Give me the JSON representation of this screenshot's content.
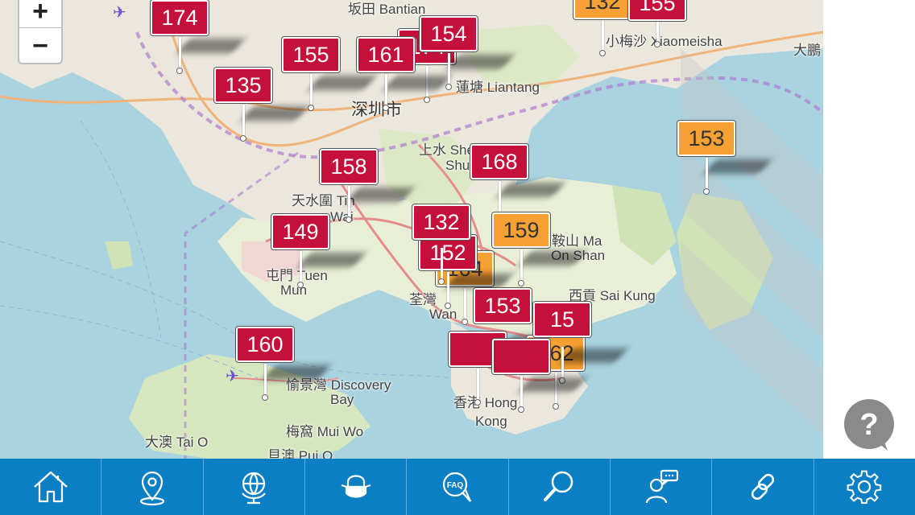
{
  "map": {
    "zoom_in_label": "+",
    "zoom_out_label": "−",
    "place_labels": [
      {
        "id": "bantian",
        "text": "坂田 Bantian"
      },
      {
        "id": "shenzhen",
        "text": "深圳市"
      },
      {
        "id": "liantang",
        "text": "蓮塘 Liantang"
      },
      {
        "id": "xiaomeisha",
        "text": "小梅沙 Xiaomeisha"
      },
      {
        "id": "dapeng",
        "text": "大鵬"
      },
      {
        "id": "sheungshui",
        "text": "上水 Sheung"
      },
      {
        "id": "shui",
        "text": "Shui"
      },
      {
        "id": "tinshuiwai",
        "text": "天水圍 Tin"
      },
      {
        "id": "wai",
        "text": "Wai"
      },
      {
        "id": "maonshan",
        "text": "鞍山 Ma"
      },
      {
        "id": "onshan",
        "text": "On Shan"
      },
      {
        "id": "tuenmun",
        "text": "屯門 Tuen"
      },
      {
        "id": "mun",
        "text": "Mun"
      },
      {
        "id": "tsuenwan",
        "text": "荃灣"
      },
      {
        "id": "wan",
        "text": "Wan"
      },
      {
        "id": "saikung",
        "text": "西貢 Sai Kung"
      },
      {
        "id": "discovery",
        "text": "愉景灣 Discovery"
      },
      {
        "id": "bay",
        "text": "Bay"
      },
      {
        "id": "hongkong",
        "text": "香港 Hong"
      },
      {
        "id": "kong",
        "text": "Kong"
      },
      {
        "id": "muiwo",
        "text": "梅窩 Mui Wo"
      },
      {
        "id": "taio",
        "text": "大澳 Tai O"
      },
      {
        "id": "puio",
        "text": "貝澳 Pui O"
      }
    ],
    "stations": [
      {
        "aqhi": "174",
        "level": "red"
      },
      {
        "aqhi": "132",
        "level": "orange"
      },
      {
        "aqhi": "155",
        "level": "red"
      },
      {
        "aqhi": "155",
        "level": "red"
      },
      {
        "aqhi": "174",
        "level": "red"
      },
      {
        "aqhi": "161",
        "level": "red"
      },
      {
        "aqhi": "154",
        "level": "red"
      },
      {
        "aqhi": "135",
        "level": "orange"
      },
      {
        "aqhi": "153",
        "level": "red"
      },
      {
        "aqhi": "158",
        "level": "red"
      },
      {
        "aqhi": "168",
        "level": "red"
      },
      {
        "aqhi": "149",
        "level": "orange"
      },
      {
        "aqhi": "164",
        "level": "red"
      },
      {
        "aqhi": "159",
        "level": "red"
      },
      {
        "aqhi": "152",
        "level": "red"
      },
      {
        "aqhi": "132",
        "level": "orange"
      },
      {
        "aqhi": "153",
        "level": "red"
      },
      {
        "aqhi": "162",
        "level": "red"
      },
      {
        "aqhi": "15",
        "level": "red"
      },
      {
        "aqhi": "160",
        "level": "red"
      }
    ]
  },
  "colors": {
    "red": "#c4103a",
    "orange": "#f7a033",
    "navbar": "#0b7fc4"
  },
  "help_button": {
    "label": "?",
    "icon": "question-bubble-icon"
  },
  "navbar": [
    {
      "id": "home",
      "icon": "home-icon"
    },
    {
      "id": "location",
      "icon": "location-pin-icon"
    },
    {
      "id": "globe",
      "icon": "globe-icon"
    },
    {
      "id": "health",
      "icon": "mask-face-icon"
    },
    {
      "id": "faq",
      "icon": "faq-bubble-icon"
    },
    {
      "id": "search",
      "icon": "search-icon"
    },
    {
      "id": "forecast",
      "icon": "speaker-chat-icon"
    },
    {
      "id": "links",
      "icon": "link-icon"
    },
    {
      "id": "settings",
      "icon": "gear-icon"
    }
  ]
}
